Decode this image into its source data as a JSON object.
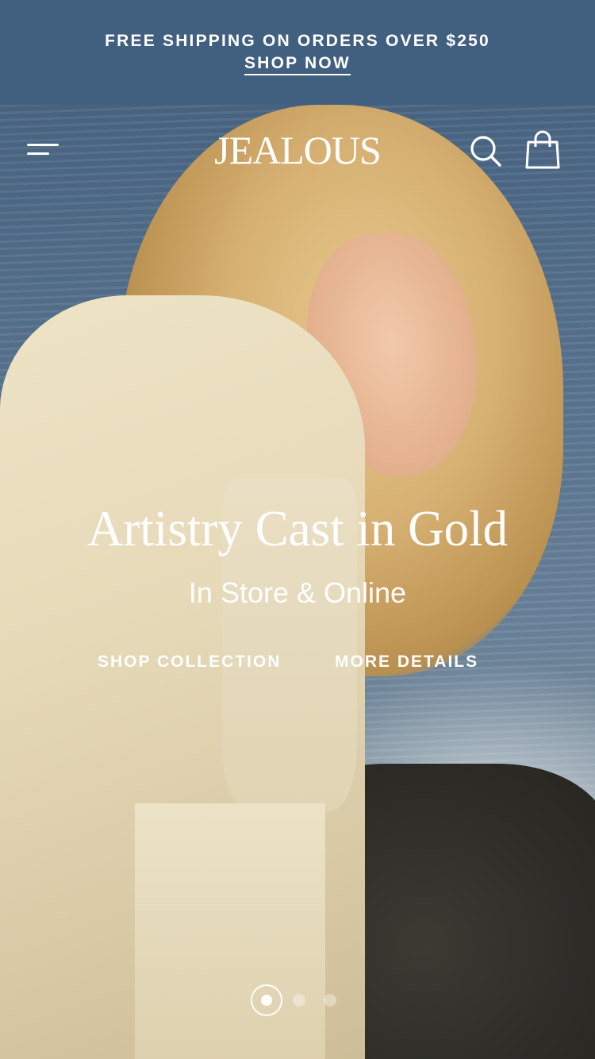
{
  "announcement": {
    "text": "FREE SHIPPING ON ORDERS OVER $250",
    "link_label": "SHOP NOW"
  },
  "header": {
    "logo": "JEALOUS",
    "icons": [
      "menu-icon",
      "search-icon",
      "cart-icon"
    ]
  },
  "hero": {
    "title": "Artistry Cast in Gold",
    "subtitle": "In Store & Online",
    "cta_primary": "SHOP COLLECTION",
    "cta_secondary": "MORE DETAILS",
    "slides": {
      "current": 1,
      "total": 3
    }
  },
  "colors": {
    "announcement_bg": "#415f7e",
    "text": "#ffffff"
  }
}
